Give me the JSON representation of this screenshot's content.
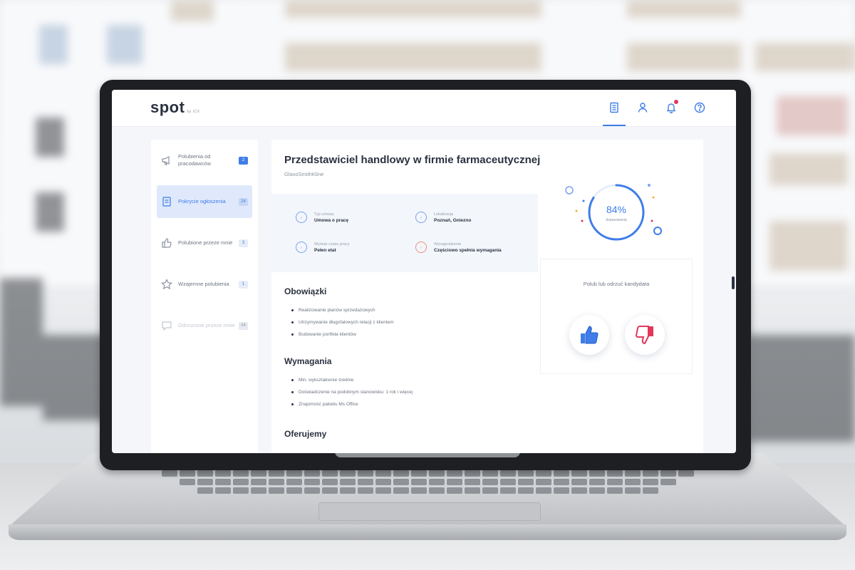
{
  "app": {
    "brand": "spot",
    "brand_suffix": "by ICX"
  },
  "topbar": {
    "icons": [
      "document-icon",
      "user-icon",
      "bell-icon",
      "help-icon"
    ]
  },
  "sidebar": {
    "items": [
      {
        "label": "Polubienia od pracodawców",
        "count": "2",
        "icon": "megaphone-icon"
      },
      {
        "label": "Pokrycie ogłoszenia",
        "count": "24",
        "icon": "clipboard-icon"
      },
      {
        "label": "Polubione przeze mnie",
        "count": "3",
        "icon": "thumb-up-icon"
      },
      {
        "label": "Wzajemne polubienia",
        "count": "1",
        "icon": "star-icon"
      },
      {
        "label": "Odrzucone przeze mnie",
        "count": "44",
        "icon": "chat-icon"
      }
    ]
  },
  "job": {
    "title": "Przedstawiciel handlowy w firmie farmaceutycznej",
    "company": "GlaxoSmithKline",
    "info": [
      {
        "key": "Typ umowy",
        "value": "Umowa o pracę"
      },
      {
        "key": "Lokalizacja",
        "value": "Poznań, Gniezno"
      },
      {
        "key": "Wymiar czasu pracy",
        "value": "Pełen etat"
      },
      {
        "key": "Wynagrodzenie",
        "value": "Częściowo spełnia wymagania"
      }
    ],
    "sections": [
      {
        "title": "Obowiązki",
        "items": [
          "Realizowanie planów sprzedażowych",
          "Utrzymywanie długofalowych relacji z klientem",
          "Budowanie portfela klientów"
        ]
      },
      {
        "title": "Wymagania",
        "items": [
          "Min. wykształcenie średnie",
          "Doświadczenie na podobnym stanowisku: 1 rok i więcej",
          "Znajomość pakietu Ms Office"
        ]
      },
      {
        "title": "Oferujemy",
        "items": []
      }
    ]
  },
  "match": {
    "percent": "84%",
    "label": "dopasowania",
    "value": 0.84,
    "accent": "#3f7de8"
  },
  "decision": {
    "prompt": "Polub lub odrzuć kandydata",
    "like_color": "#3f7de8",
    "dislike_color": "#e0395b"
  }
}
